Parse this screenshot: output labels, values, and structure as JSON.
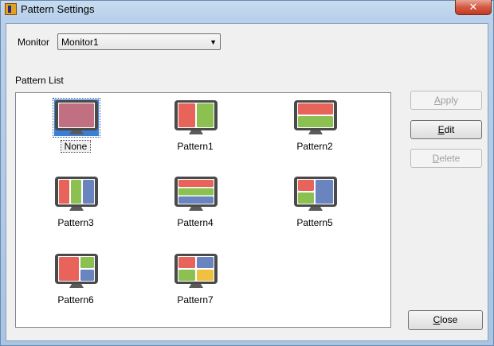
{
  "window": {
    "title": "Pattern Settings",
    "close_glyph": "✕"
  },
  "monitor": {
    "label": "Monitor",
    "selected": "Monitor1",
    "arrow_glyph": "▼"
  },
  "pattern_list": {
    "label": "Pattern List",
    "items": [
      {
        "name": "None",
        "selected": true
      },
      {
        "name": "Pattern1"
      },
      {
        "name": "Pattern2"
      },
      {
        "name": "Pattern3"
      },
      {
        "name": "Pattern4"
      },
      {
        "name": "Pattern5"
      },
      {
        "name": "Pattern6"
      },
      {
        "name": "Pattern7"
      }
    ]
  },
  "buttons": {
    "apply": {
      "accel": "A",
      "rest": "pply",
      "enabled": false
    },
    "edit": {
      "accel": "E",
      "rest": "dit",
      "enabled": true
    },
    "delete": {
      "accel": "D",
      "rest": "elete",
      "enabled": false
    },
    "close": {
      "accel": "C",
      "rest": "lose",
      "enabled": true
    }
  },
  "colors": {
    "red": "#e8645a",
    "green": "#8cc152",
    "blue": "#6a84c0",
    "yellow": "#f0c040",
    "none_fill": "#c07080",
    "bezel": "#4a4a4a"
  }
}
